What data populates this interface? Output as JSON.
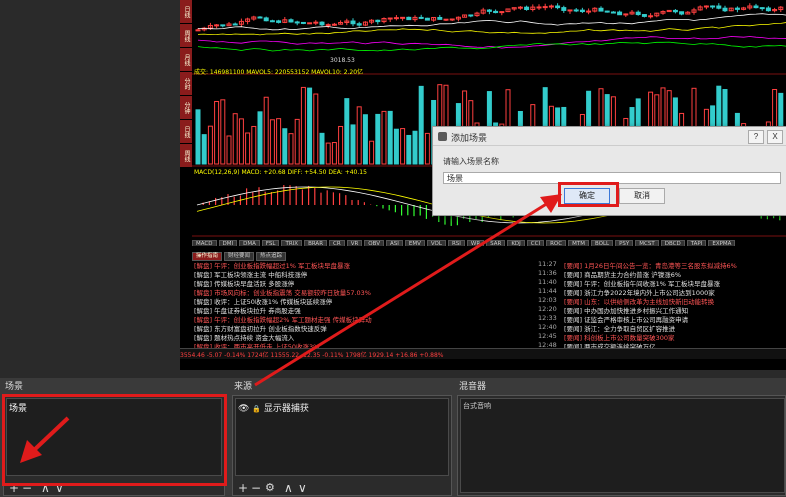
{
  "preview": {
    "left_tabs": [
      "日线",
      "周线",
      "月线",
      "分时",
      "分钟",
      "日线",
      "周线"
    ],
    "vol_label": "成交: 146981100  MAVOL5: 220553152  MAVOL10: 2.20亿",
    "macd_label": "MACD(12,26,9)  MACD: +20.68  DIFF: +54.50  DEA: +40.15",
    "low_price": "3018.53",
    "indicator_tabs": [
      "MACD",
      "DMI",
      "DMA",
      "FSL",
      "TRIX",
      "BRAR",
      "CR",
      "VR",
      "OBV",
      "ASI",
      "EMV",
      "VOL",
      "RSI",
      "WR",
      "SAR",
      "KDJ",
      "CCI",
      "ROC",
      "MTM",
      "BOLL",
      "PSY",
      "MCST",
      "DBCD",
      "TAPI",
      "EXPMA"
    ],
    "news_tabs": [
      "操作指南",
      "财经要闻",
      "热点追踪"
    ],
    "news_left": [
      "[解盘] 午评：创业板指跌幅超过1% 军工板块早盘暴涨",
      "[解盘] 军工板块领涨主流 中船科技涨停",
      "[解盘] 传媒板块早盘活跃 多股涨停",
      "[解盘] 市场风向标：创业板指震荡 交易额较昨日放量57.03%",
      "[解盘] 收评：上证50收涨1% 传媒板块延续涨停",
      "[解盘] 午盘证券板块拉升 券商股走强",
      "[解盘] 午评：创业板指跌幅超2% 军工题材走强 传媒板块异动",
      "[解盘] 东方财富盘初拉升 创业板指数快速反弹",
      "[解盘] 题材热点持续 资金大幅流入",
      "[解盘] 收评：两市高开低走 上证50收涨3%"
    ],
    "news_right": [
      "[要闻] 1月26日午间公告一览：青岛港等三名股东拟减持6%",
      "[要闻] 商品期货主力合约普涨 沪镍涨6%",
      "[要闻] 午评：创业板指午间收涨1% 军工板块早盘暴涨",
      "[要闻] 浙江力争2022年境内外上市公司达到1000家",
      "[要闻] 山东：以供给侧改革为主线加快新旧动能转换",
      "[要闻] 中办国办加快推进乡村振兴工作通知",
      "[要闻] 证监会严格审核上市公司再融资申请",
      "[要闻] 浙江：全力争取自贸区扩容推进",
      "[要闻] 科创板上市公司数量突破300家",
      "[要闻] 两市成交额连续突破万亿"
    ],
    "news_times": [
      "11:27",
      "11:36",
      "11:40",
      "11:44",
      "12:03",
      "12:20",
      "12:33",
      "12:40",
      "12:45",
      "12:48"
    ],
    "status_bar": "  3554.46   -5.07   -0.14%   1724亿   11555.22   -12.35   -0.11%   1798亿   1929.14   +16.86   +0.88%"
  },
  "dialog": {
    "title": "添加场景",
    "prompt": "请输入场景名称",
    "input_value": "场景",
    "ok": "确定",
    "cancel": "取消",
    "help": "?",
    "close": "X"
  },
  "docks": {
    "scenes": {
      "title": "场景",
      "items": [
        "场景"
      ]
    },
    "sources": {
      "title": "来源",
      "items": [
        "显示器捕获"
      ]
    },
    "mixer": {
      "title": "混音器",
      "track": "台式音响"
    }
  },
  "colors": {
    "highlight_red": "#e01b1b",
    "up": "#ff4040",
    "down": "#33cccc"
  },
  "icons": {
    "eye": "eye-icon",
    "lock": "lock-icon",
    "gear": "gear-icon"
  }
}
